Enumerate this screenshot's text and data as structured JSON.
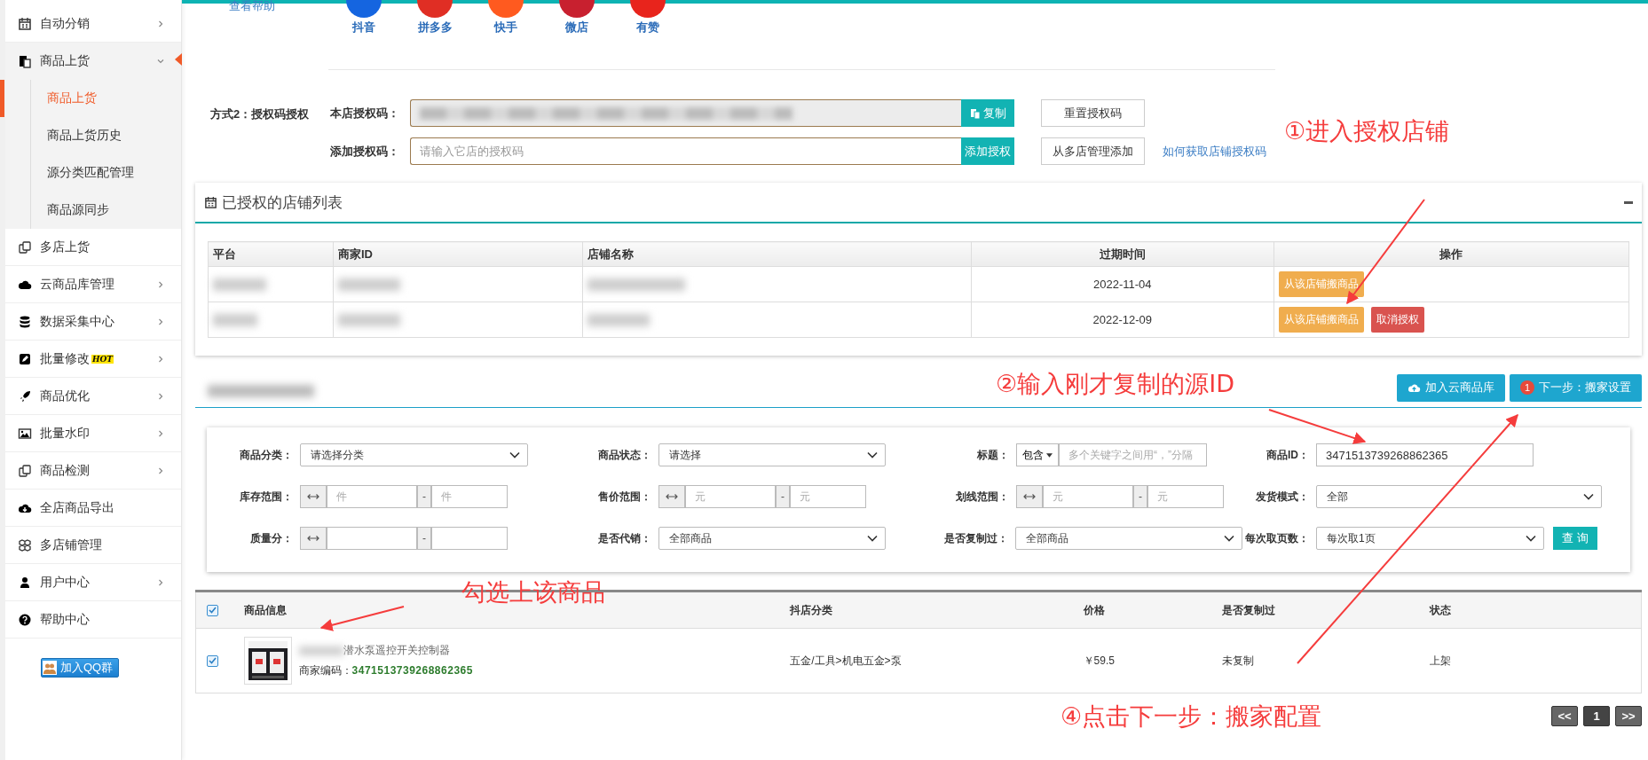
{
  "sidebar": {
    "items": [
      {
        "label": "自动分销",
        "expandable": true,
        "expanded": false
      },
      {
        "label": "商品上货",
        "expandable": true,
        "expanded": true,
        "children": [
          {
            "label": "商品上货",
            "selected": true
          },
          {
            "label": "商品上货历史",
            "selected": false
          },
          {
            "label": "源分类匹配管理",
            "selected": false
          },
          {
            "label": "商品源同步",
            "selected": false
          }
        ]
      },
      {
        "label": "多店上货",
        "expandable": false,
        "expanded": false
      },
      {
        "label": "云商品库管理",
        "expandable": true,
        "expanded": false
      },
      {
        "label": "数据采集中心",
        "expandable": true,
        "expanded": false
      },
      {
        "label": "批量修改",
        "badge": "HOT",
        "expandable": true,
        "expanded": false
      },
      {
        "label": "商品优化",
        "expandable": true,
        "expanded": false
      },
      {
        "label": "批量水印",
        "expandable": true,
        "expanded": false
      },
      {
        "label": "商品检测",
        "expandable": true,
        "expanded": false
      },
      {
        "label": "全店商品导出",
        "expandable": false,
        "expanded": false
      },
      {
        "label": "多店铺管理",
        "expandable": false,
        "expanded": false
      },
      {
        "label": "用户中心",
        "expandable": true,
        "expanded": false
      },
      {
        "label": "帮助中心",
        "expandable": false,
        "expanded": false
      }
    ],
    "qq_button": "加入QQ群"
  },
  "top": {
    "help_link": "查看帮助",
    "platforms": [
      {
        "name": "抖音",
        "color": "#1565e0"
      },
      {
        "name": "拼多多",
        "color": "#e02e24"
      },
      {
        "name": "快手",
        "color": "#ff5a1f"
      },
      {
        "name": "微店",
        "color": "#c8202f"
      },
      {
        "name": "有赞",
        "color": "#e8241c"
      }
    ]
  },
  "auth": {
    "method_label": "方式2：授权码授权",
    "own_code": {
      "label": "本店授权码：",
      "button": "复制",
      "secondary_button": "重置授权码"
    },
    "add_code": {
      "label": "添加授权码：",
      "placeholder": "请输入它店的授权码",
      "button": "添加授权",
      "secondary_button": "从多店管理添加"
    },
    "help_link": "如何获取店铺授权码"
  },
  "authorized_shops": {
    "title": "已授权的店铺列表",
    "columns": [
      "平台",
      "商家ID",
      "店铺名称",
      "过期时间",
      "操作"
    ],
    "rows": [
      {
        "expiry": "2022-11-04",
        "actions": [
          {
            "label": "从该店铺搬商品",
            "kind": "warning"
          }
        ]
      },
      {
        "expiry": "2022-12-09",
        "actions": [
          {
            "label": "从该店铺搬商品",
            "kind": "warning"
          },
          {
            "label": "取消授权",
            "kind": "danger"
          }
        ]
      }
    ]
  },
  "product_list": {
    "buttons": [
      {
        "label": "加入云商品库",
        "kind": "cloud"
      },
      {
        "label": "下一步：搬家设置",
        "kind": "step",
        "badge": "1"
      }
    ],
    "filters": [
      {
        "label": "商品分类：",
        "kind": "select",
        "value": "请选择分类"
      },
      {
        "label": "商品状态：",
        "kind": "select",
        "value": "请选择"
      },
      {
        "label": "标题：",
        "kind": "match",
        "dropdown": "包含",
        "placeholder": "多个关键字之间用“，”分隔"
      },
      {
        "label": "商品ID：",
        "kind": "input",
        "value": "3471513739268862365"
      },
      {
        "label": "库存范围：",
        "kind": "range",
        "separator": "-",
        "min_placeholder": "件",
        "max_placeholder": "件"
      },
      {
        "label": "售价范围：",
        "kind": "range",
        "separator": "-",
        "min_placeholder": "元",
        "max_placeholder": "元"
      },
      {
        "label": "划线范围：",
        "kind": "range",
        "separator": "-",
        "min_placeholder": "元",
        "max_placeholder": "元"
      },
      {
        "label": "发货模式：",
        "kind": "select",
        "value": "全部"
      },
      {
        "label": "质量分：",
        "kind": "range",
        "separator": "-"
      },
      {
        "label": "是否代销：",
        "kind": "select",
        "value": "全部商品"
      },
      {
        "label": "是否复制过：",
        "kind": "select",
        "value": "全部商品"
      },
      {
        "label": "每次取页数：",
        "kind": "select",
        "value": "每次取1页",
        "button": "查 询"
      }
    ],
    "table": {
      "all_checked": true,
      "columns": [
        "商品信息",
        "抖店分类",
        "价格",
        "是否复制过",
        "状态"
      ],
      "rows": [
        {
          "checked": true,
          "title": "潜水泵遥控开关控制器",
          "code_label": "商家编码：",
          "code": "3471513739268862365",
          "category": "五金/工具>机电五金>泵",
          "price": "￥59.5",
          "copied": "未复制",
          "status": "上架"
        }
      ]
    },
    "pagination": [
      {
        "label": "<<",
        "selected": false
      },
      {
        "label": "1",
        "selected": true
      },
      {
        "label": ">>",
        "selected": false
      }
    ]
  },
  "annotations": [
    {
      "text": "①进入授权店铺"
    },
    {
      "text": "②输入刚才复制的源ID"
    },
    {
      "text": "勾选上该商品"
    },
    {
      "text": "④点击下一步：搬家配置"
    }
  ]
}
